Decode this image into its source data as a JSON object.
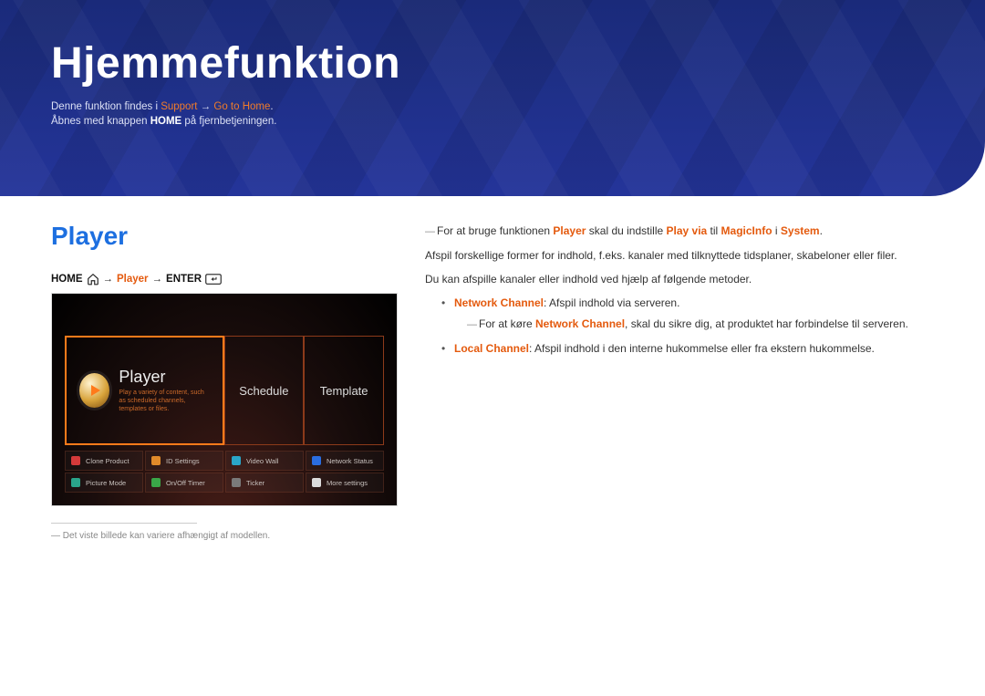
{
  "banner": {
    "title": "Hjemmefunktion",
    "line1_pre": "Denne funktion findes i ",
    "line1_hl1": "Support",
    "line1_arrow": " → ",
    "line1_hl2": "Go to Home",
    "line1_post": ".",
    "line2_pre": "Åbnes med knappen ",
    "line2_bold": "HOME",
    "line2_post": " på fjernbetjeningen."
  },
  "left": {
    "heading": "Player",
    "nav": {
      "home": "HOME",
      "arrow": "→",
      "player": "Player",
      "enter": "ENTER"
    },
    "shot": {
      "tile_player": "Player",
      "tile_player_desc": "Play a variety of content, such as scheduled channels, templates or files.",
      "tile_schedule": "Schedule",
      "tile_template": "Template",
      "grid": [
        [
          "Clone Product",
          "ID Settings",
          "Video Wall",
          "Network Status"
        ],
        [
          "Picture Mode",
          "On/Off Timer",
          "Ticker",
          "More settings"
        ]
      ]
    },
    "footnote": "Det viste billede kan variere afhængigt af modellen."
  },
  "right": {
    "p1_pre": "For at bruge funktionen ",
    "p1_b1": "Player",
    "p1_mid1": " skal du indstille ",
    "p1_b2": "Play via",
    "p1_mid2": " til ",
    "p1_b3": "MagicInfo",
    "p1_mid3": " i ",
    "p1_b4": "System",
    "p1_post": ".",
    "p2": "Afspil forskellige former for indhold, f.eks. kanaler med tilknyttede tidsplaner, skabeloner eller filer.",
    "p3": "Du kan afspille kanaler eller indhold ved hjælp af følgende metoder.",
    "li1_b": "Network Channel",
    "li1_rest": ": Afspil indhold via serveren.",
    "li1_sub_pre": "For at køre ",
    "li1_sub_b": "Network Channel",
    "li1_sub_post": ", skal du sikre dig, at produktet har forbindelse til serveren.",
    "li2_b": "Local Channel",
    "li2_rest": ": Afspil indhold i den interne hukommelse eller fra ekstern hukommelse."
  }
}
